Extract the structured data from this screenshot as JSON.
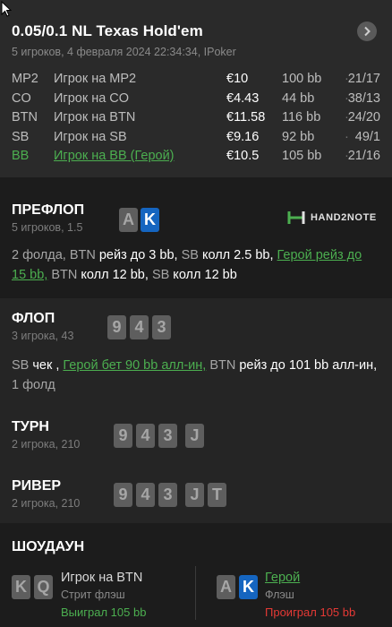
{
  "header": {
    "title": "0.05/0.1 NL Texas Hold'em",
    "subtitle": "5 игроков, 4 февраля 2024 22:34:34, IPoker",
    "players": [
      {
        "pos": "MP2",
        "name": "Игрок на MP2",
        "amount": "€10",
        "bb": "100 bb",
        "dot": "·",
        "stat": "21/17",
        "hero": false
      },
      {
        "pos": "CO",
        "name": "Игрок на CO",
        "amount": "€4.43",
        "bb": "44 bb",
        "dot": "·",
        "stat": "38/13",
        "hero": false
      },
      {
        "pos": "BTN",
        "name": "Игрок на BTN",
        "amount": "€11.58",
        "bb": "116 bb",
        "dot": "·",
        "stat": "24/20",
        "hero": false
      },
      {
        "pos": "SB",
        "name": "Игрок на SB",
        "amount": "€9.16",
        "bb": "92 bb",
        "dot": "·",
        "stat": "49/1",
        "hero": false
      },
      {
        "pos": "BB",
        "name": "Игрок на BB (Герой)",
        "amount": "€10.5",
        "bb": "105 bb",
        "dot": "·",
        "stat": "21/16",
        "hero": true
      }
    ]
  },
  "preflop": {
    "title": "ПРЕФЛОП",
    "sub": "5 игроков, 1.5",
    "cards": [
      "A",
      "K"
    ],
    "logo": "HAND2NOTE",
    "actions": {
      "a1": "2 фолда, ",
      "a2": "BTN",
      "a3": " рейз до 3 bb, ",
      "a4": "SB",
      "a5": " колл 2.5 bb, ",
      "a6": "Герой рейз до 15 bb,",
      "a7": " BTN",
      "a8": " колл 12 bb, ",
      "a9": "SB",
      "a10": " колл 12 bb"
    }
  },
  "flop": {
    "title": "ФЛОП",
    "sub": "3 игрока, 43",
    "cards": [
      "9",
      "4",
      "3"
    ],
    "actions": {
      "a1": "SB",
      "a2": " чек , ",
      "a3": "Герой бет 90 bb алл-ин,",
      "a4": " BTN",
      "a5": " рейз до 101 bb алл-ин, ",
      "a6": "1 фолд"
    }
  },
  "turn": {
    "title": "ТУРН",
    "sub": "2 игрока, 210",
    "cards": [
      "9",
      "4",
      "3",
      "J"
    ]
  },
  "river": {
    "title": "РИВЕР",
    "sub": "2 игрока, 210",
    "cards": [
      "9",
      "4",
      "3",
      "J",
      "T"
    ]
  },
  "showdown": {
    "title": "ШОУДАУН",
    "left": {
      "cards": [
        "K",
        "Q"
      ],
      "name": "Игрок на BTN",
      "hand": "Стрит флэш",
      "result": "Выиграл 105 bb"
    },
    "right": {
      "cards": [
        "A",
        "K"
      ],
      "name": "Герой",
      "hand": "Флэш",
      "result": "Проиграл 105 bb"
    }
  },
  "colors": {
    "hero": "#4caf50",
    "win": "#4caf50",
    "loss": "#e53935",
    "blue_card": "#1565c0",
    "grey_card": "#5e5e5e"
  }
}
